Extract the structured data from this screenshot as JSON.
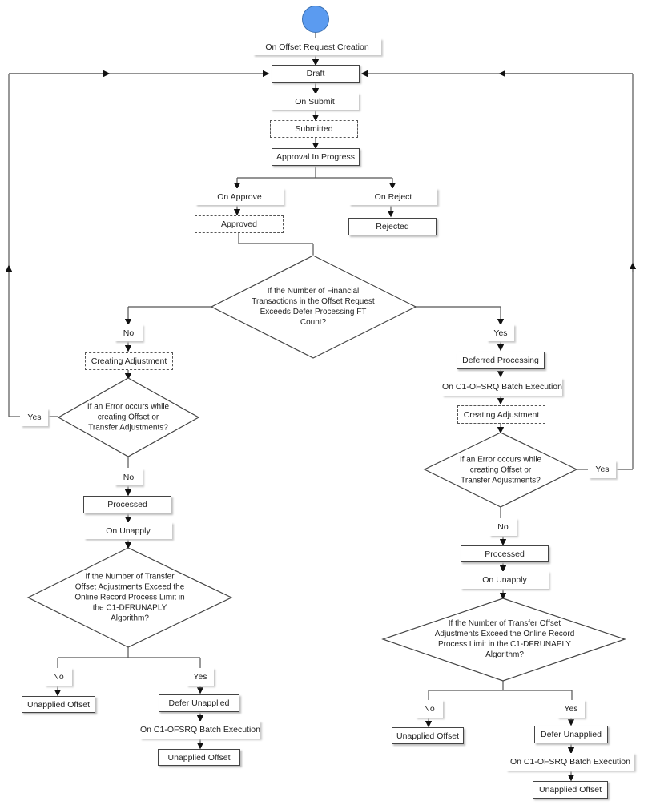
{
  "diagram": {
    "start": "start-node",
    "top": {
      "on_creation": "On Offset Request Creation",
      "draft": "Draft",
      "on_submit": "On Submit",
      "submitted": "Submitted",
      "approval_in_progress": "Approval In Progress",
      "on_approve": "On Approve",
      "on_reject": "On Reject",
      "approved": "Approved",
      "rejected": "Rejected",
      "decision_defer": "If the Number of Financial Transactions in the Offset Request Exceeds Defer Processing FT Count?"
    },
    "left": {
      "no": "No",
      "creating_adjustment": "Creating Adjustment",
      "decision_error": "If an Error occurs while creating Offset or Transfer Adjustments?",
      "yes": "Yes",
      "no2": "No",
      "processed": "Processed",
      "on_unapply": "On Unapply",
      "decision_unapply": "If the Number of Transfer Offset Adjustments Exceed the Online Record Process Limit in the C1-DFRUNAPLY Algorithm?",
      "no3": "No",
      "yes3": "Yes",
      "unapplied_offset_no": "Unapplied Offset",
      "defer_unapplied": "Defer Unapplied",
      "on_batch": "On C1-OFSRQ Batch Execution",
      "unapplied_offset_yes": "Unapplied Offset"
    },
    "right": {
      "yes": "Yes",
      "deferred_processing": "Deferred Processing",
      "on_batch": "On C1-OFSRQ Batch Execution",
      "creating_adjustment": "Creating Adjustment",
      "decision_error": "If an Error occurs while creating Offset or Transfer Adjustments?",
      "yes2": "Yes",
      "no2": "No",
      "processed": "Processed",
      "on_unapply": "On Unapply",
      "decision_unapply": "If the Number of Transfer Offset Adjustments Exceed the Online Record Process Limit in the C1-DFRUNAPLY Algorithm?",
      "no3": "No",
      "yes3": "Yes",
      "unapplied_offset_no": "Unapplied Offset",
      "defer_unapplied": "Defer Unapplied",
      "on_batch2": "On C1-OFSRQ Batch Execution",
      "unapplied_offset_yes": "Unapplied Offset"
    }
  }
}
